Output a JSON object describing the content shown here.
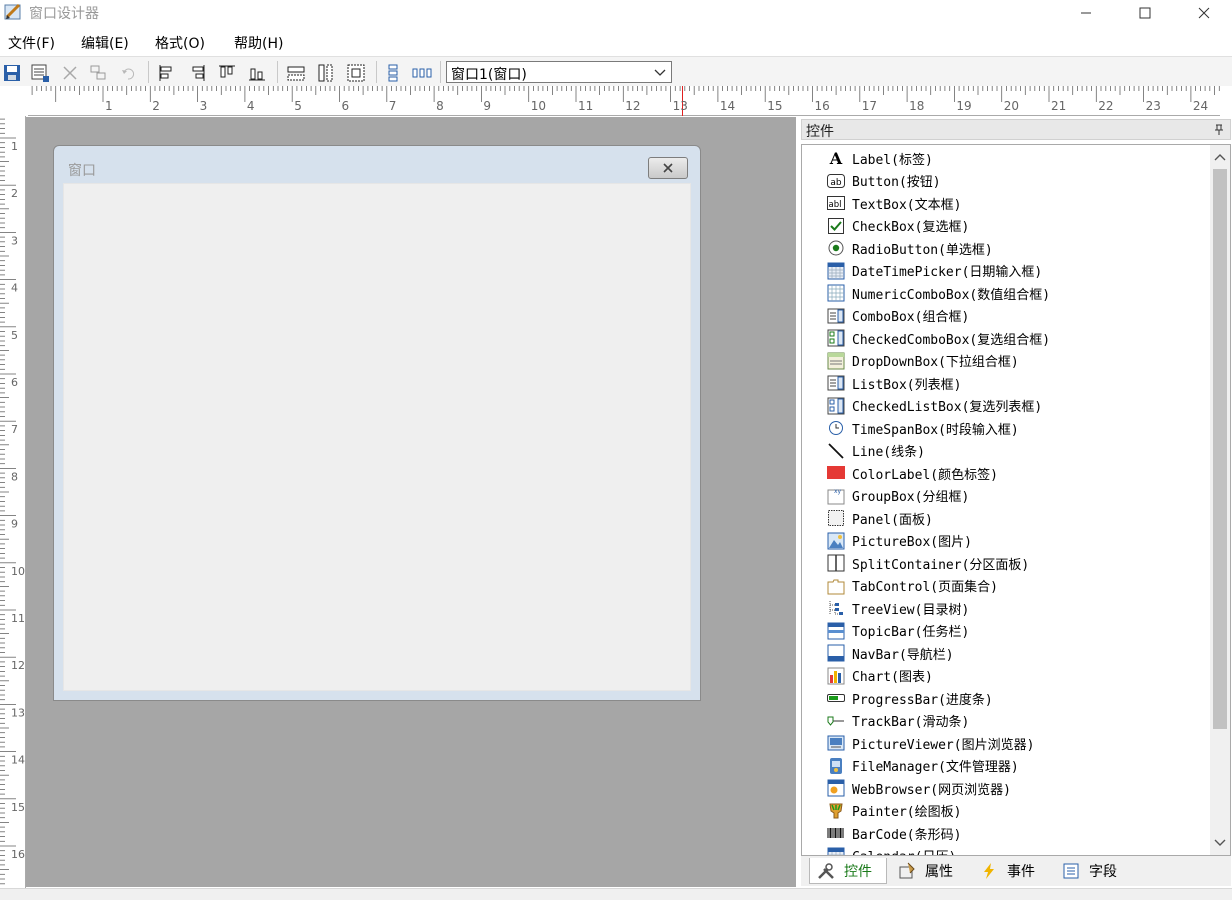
{
  "app": {
    "title": "窗口设计器"
  },
  "menu": [
    {
      "label": "文件(F)"
    },
    {
      "label": "编辑(E)"
    },
    {
      "label": "格式(O)"
    },
    {
      "label": "帮助(H)"
    }
  ],
  "toolbar": {
    "window_select_value": "窗口1(窗口)",
    "buttons": [
      "save-icon",
      "save-all-icon",
      "delete-icon",
      "copy-icon",
      "undo-icon",
      "align-left-icon",
      "align-right-icon",
      "align-top-icon",
      "align-bottom-icon",
      "same-width-icon",
      "same-height-icon",
      "same-size-icon",
      "vertical-distribute-icon",
      "horizontal-distribute-icon"
    ]
  },
  "ruler": {
    "horizontal": [
      "1",
      "2",
      "3",
      "4",
      "5",
      "6",
      "7",
      "8",
      "9",
      "10",
      "11",
      "12",
      "13",
      "14",
      "15",
      "16",
      "17",
      "18",
      "19",
      "20",
      "21",
      "22",
      "23",
      "24"
    ],
    "vertical": [
      "1",
      "2",
      "3",
      "4",
      "5",
      "6",
      "7",
      "8",
      "9",
      "10",
      "11",
      "12",
      "13",
      "14",
      "15",
      "16"
    ]
  },
  "form": {
    "title": "窗口"
  },
  "panel": {
    "title": "控件"
  },
  "controls": [
    {
      "label": "Label(标签)",
      "icon": "label-icon"
    },
    {
      "label": "Button(按钮)",
      "icon": "button-icon"
    },
    {
      "label": "TextBox(文本框)",
      "icon": "textbox-icon"
    },
    {
      "label": "CheckBox(复选框)",
      "icon": "checkbox-icon"
    },
    {
      "label": "RadioButton(单选框)",
      "icon": "radio-icon"
    },
    {
      "label": "DateTimePicker(日期输入框)",
      "icon": "calendar-icon"
    },
    {
      "label": "NumericComboBox(数值组合框)",
      "icon": "numeric-combobox-icon"
    },
    {
      "label": "ComboBox(组合框)",
      "icon": "combobox-icon"
    },
    {
      "label": "CheckedComboBox(复选组合框)",
      "icon": "checked-combobox-icon"
    },
    {
      "label": "DropDownBox(下拉组合框)",
      "icon": "dropdown-icon"
    },
    {
      "label": "ListBox(列表框)",
      "icon": "listbox-icon"
    },
    {
      "label": "CheckedListBox(复选列表框)",
      "icon": "checked-listbox-icon"
    },
    {
      "label": "TimeSpanBox(时段输入框)",
      "icon": "clock-icon"
    },
    {
      "label": "Line(线条)",
      "icon": "line-icon"
    },
    {
      "label": "ColorLabel(颜色标签)",
      "icon": "color-label-icon"
    },
    {
      "label": "GroupBox(分组框)",
      "icon": "groupbox-icon"
    },
    {
      "label": "Panel(面板)",
      "icon": "panel-icon"
    },
    {
      "label": "PictureBox(图片)",
      "icon": "picture-icon"
    },
    {
      "label": "SplitContainer(分区面板)",
      "icon": "split-container-icon"
    },
    {
      "label": "TabControl(页面集合)",
      "icon": "tab-control-icon"
    },
    {
      "label": "TreeView(目录树)",
      "icon": "tree-icon"
    },
    {
      "label": "TopicBar(任务栏)",
      "icon": "topic-bar-icon"
    },
    {
      "label": "NavBar(导航栏)",
      "icon": "nav-bar-icon"
    },
    {
      "label": "Chart(图表)",
      "icon": "chart-icon"
    },
    {
      "label": "ProgressBar(进度条)",
      "icon": "progress-bar-icon"
    },
    {
      "label": "TrackBar(滑动条)",
      "icon": "track-bar-icon"
    },
    {
      "label": "PictureViewer(图片浏览器)",
      "icon": "picture-viewer-icon"
    },
    {
      "label": "FileManager(文件管理器)",
      "icon": "file-manager-icon"
    },
    {
      "label": "WebBrowser(网页浏览器)",
      "icon": "web-browser-icon"
    },
    {
      "label": "Painter(绘图板)",
      "icon": "painter-icon"
    },
    {
      "label": "BarCode(条形码)",
      "icon": "barcode-icon"
    },
    {
      "label": "Calendar(日历)",
      "icon": "calendar-icon"
    }
  ],
  "tabs": [
    {
      "label": "控件",
      "icon": "tools-icon"
    },
    {
      "label": "属性",
      "icon": "properties-icon"
    },
    {
      "label": "事件",
      "icon": "lightning-icon"
    },
    {
      "label": "字段",
      "icon": "fields-icon"
    }
  ],
  "colors": {
    "accent_green": "#1a7a1a",
    "surface": "#a6a6a6",
    "ruler_marker": "#e02020",
    "color_label": "#e53935"
  }
}
